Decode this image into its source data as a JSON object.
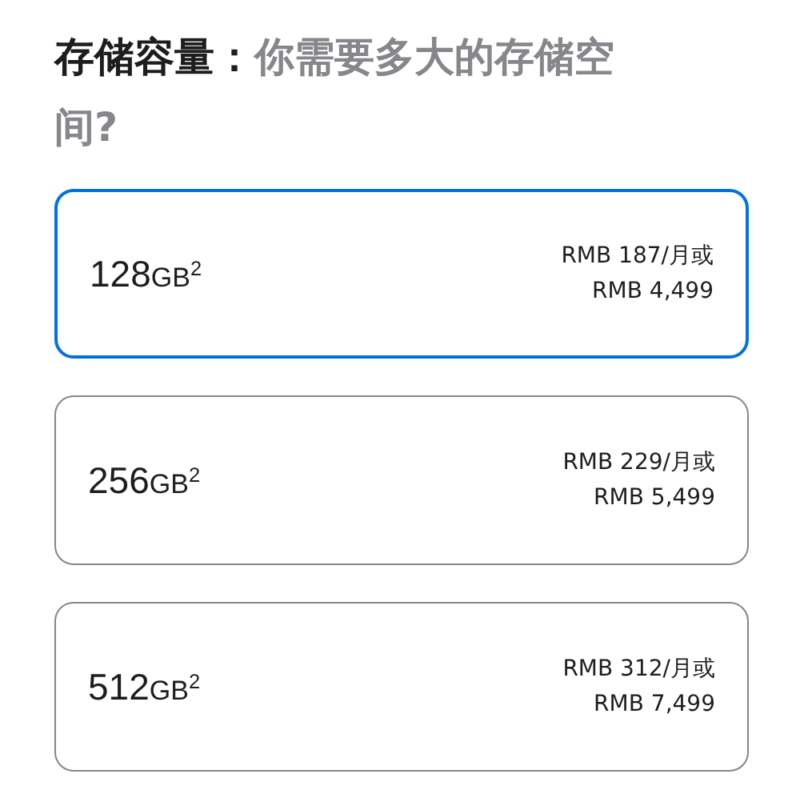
{
  "heading": "**存储容量：**你需要多大的存储空间?",
  "options": [
    {
      "size": "128",
      "unit": "GB$^{2}$",
      "price_lines": [
        "RMB 187/月或",
        "RMB 4,499"
      ],
      "selected": true
    },
    {
      "size": "256",
      "unit": "GB$^{2}$",
      "price_lines": [
        "RMB 229/月或",
        "RMB 5,499"
      ],
      "selected": false
    },
    {
      "size": "512",
      "unit": "GB$^{2}$",
      "price_lines": [
        "RMB 312/月或",
        "RMB 7,499"
      ],
      "selected": false
    }
  ]
}
